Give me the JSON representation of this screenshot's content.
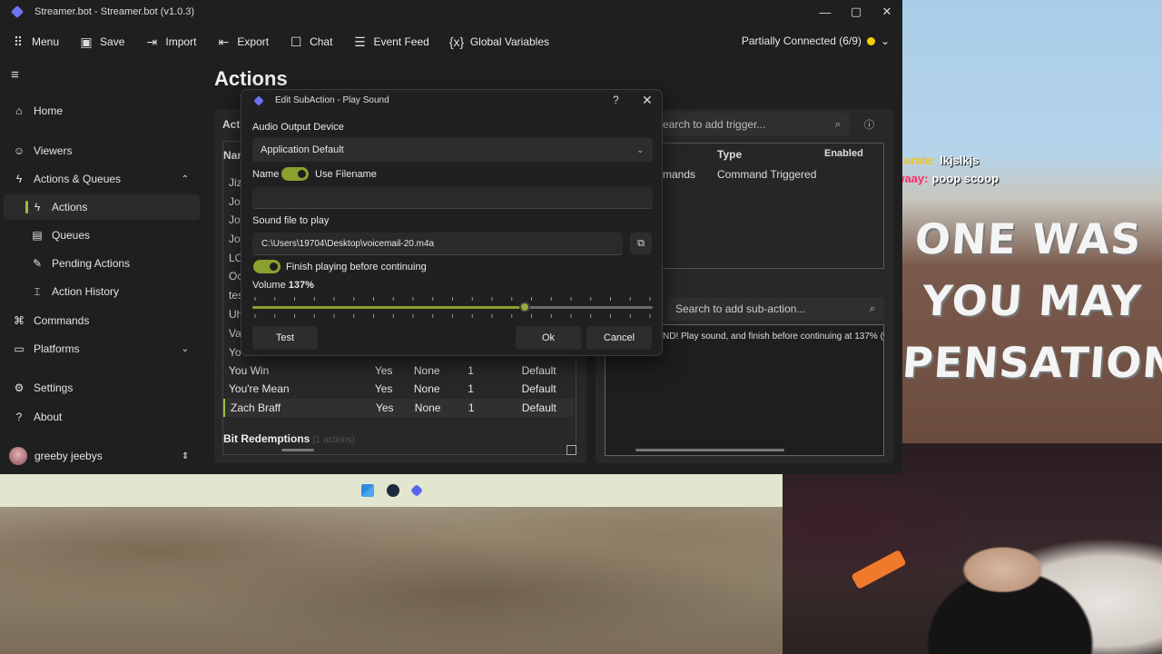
{
  "window": {
    "title": "Streamer.bot - Streamer.bot (v1.0.3)",
    "controls": [
      "—",
      "▢",
      "✕"
    ]
  },
  "toolbar": {
    "menu": "Menu",
    "save": "Save",
    "import": "Import",
    "export": "Export",
    "chat": "Chat",
    "event_feed": "Event Feed",
    "global_variables": "Global Variables",
    "connection": "Partially Connected (6/9)",
    "status_color": "#f5d000"
  },
  "sidebar": {
    "items": [
      {
        "label": "Home",
        "icon": "home-icon"
      },
      {
        "label": "Viewers",
        "icon": "users-icon"
      },
      {
        "label": "Actions & Queues",
        "icon": "bolt-icon"
      },
      {
        "label": "Actions",
        "icon": "bolt-icon"
      },
      {
        "label": "Queues",
        "icon": "queue-icon"
      },
      {
        "label": "Pending Actions",
        "icon": "pending-icon"
      },
      {
        "label": "Action History",
        "icon": "history-icon"
      },
      {
        "label": "Commands",
        "icon": "command-icon"
      },
      {
        "label": "Platforms",
        "icon": "platforms-icon"
      },
      {
        "label": "Settings",
        "icon": "gear-icon"
      },
      {
        "label": "About",
        "icon": "question-icon"
      }
    ],
    "user": "greeby jeebys"
  },
  "main": {
    "title": "Actions",
    "actions_label_partial": "Acti",
    "name_header_partial": "Nam",
    "partial_rows": [
      "Jiz",
      "Jol",
      "Jo",
      "Jo",
      "LO",
      "Oc",
      "tes",
      "Uh",
      "Va",
      "Yo"
    ],
    "rows": [
      {
        "name": "You Win",
        "enabled": "Yes",
        "group": "None",
        "count": "1",
        "queue": "Default"
      },
      {
        "name": "You're Mean",
        "enabled": "Yes",
        "group": "None",
        "count": "1",
        "queue": "Default"
      },
      {
        "name": "Zach Braff",
        "enabled": "Yes",
        "group": "None",
        "count": "1",
        "queue": "Default"
      }
    ],
    "group_title": "Bit Redemptions",
    "group_count": "(1 actions)",
    "trigger_search_placeholder": "earch to add trigger...",
    "trigger_headers": {
      "type": "Type",
      "enabled": "Enabled"
    },
    "trigger_row": {
      "name_partial": "mands",
      "type": "Command Triggered"
    },
    "subaction_search_placeholder": "Search to add sub-action...",
    "subaction_row": "ND! Play sound, and finish before continuing at 137% (v"
  },
  "dialog": {
    "title": "Edit SubAction - Play Sound",
    "help": "?",
    "close": "✕",
    "audio_label": "Audio Output Device",
    "audio_value": "Application Default",
    "name_label": "Name",
    "use_filename_label": "Use Filename",
    "name_value": "",
    "sound_label": "Sound file to play",
    "sound_value": "C:\\Users\\19704\\Desktop\\voicemail-20.m4a",
    "finish_label": "Finish playing before continuing",
    "volume_label": "Volume",
    "volume_value": "137%",
    "volume_fraction": 0.68,
    "test": "Test",
    "ok": "Ok",
    "cancel": "Cancel",
    "accent": "#8aa12e"
  },
  "stream": {
    "chat": [
      {
        "user": "JobyKarate:",
        "message": "lkjslkjs"
      },
      {
        "user": "gallowaay:",
        "message": "poop scoop"
      }
    ],
    "sign_lines": [
      "ONE WAS",
      "YOU MAY",
      "PENSATION"
    ]
  }
}
